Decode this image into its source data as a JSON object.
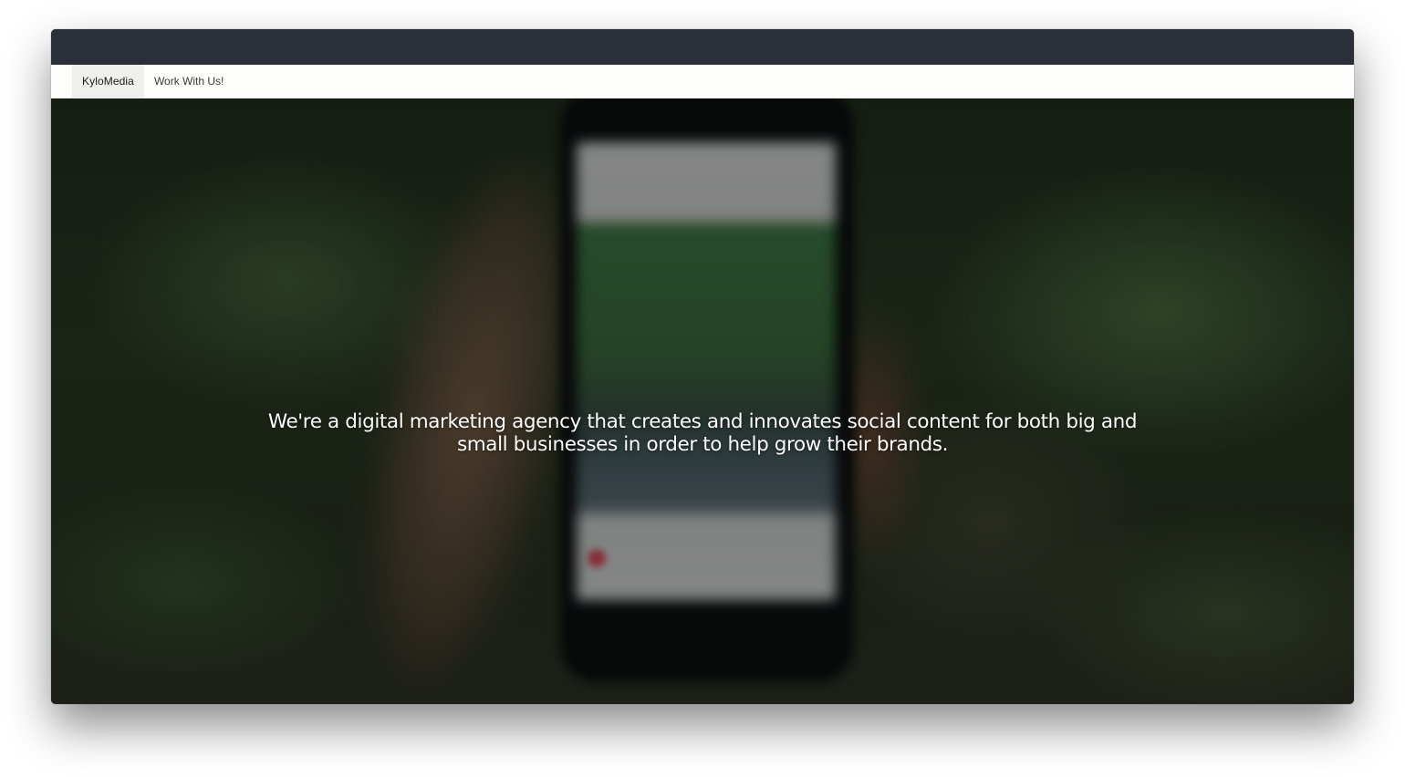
{
  "nav": {
    "brand": "KyloMedia",
    "link": "Work With Us!"
  },
  "hero": {
    "tagline": "We're a digital marketing agency that creates and innovates social content for both big and small businesses in order to help grow their brands."
  },
  "colors": {
    "titlebar": "#2b2f39",
    "navbar": "#fdfdfb",
    "brand_bg": "#efefed",
    "tagline_text": "#ffffff"
  }
}
